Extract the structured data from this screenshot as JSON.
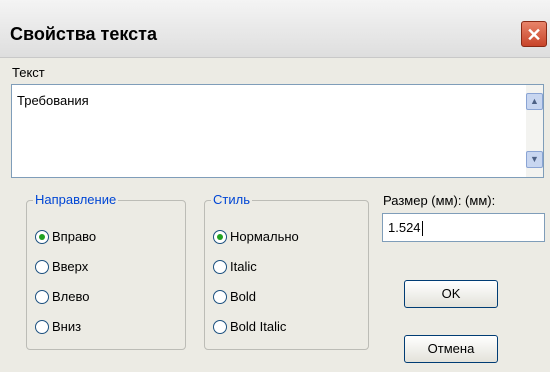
{
  "window": {
    "title": "Свойства текста",
    "close_glyph": "✕"
  },
  "text_section": {
    "label": "Текст",
    "value": "Требования",
    "scroll_up": "▲",
    "scroll_down": "▼"
  },
  "direction": {
    "legend": "Направление",
    "options": [
      "Вправо",
      "Вверх",
      "Влево",
      "Вниз"
    ],
    "selected": "Вправо"
  },
  "style": {
    "legend": "Стиль",
    "options": [
      "Нормально",
      "Italic",
      "Bold",
      "Bold Italic"
    ],
    "selected": "Нормально"
  },
  "size": {
    "label": "Размер (мм): (мм):",
    "value": "1.524"
  },
  "buttons": {
    "ok": "OK",
    "cancel": "Отмена"
  }
}
